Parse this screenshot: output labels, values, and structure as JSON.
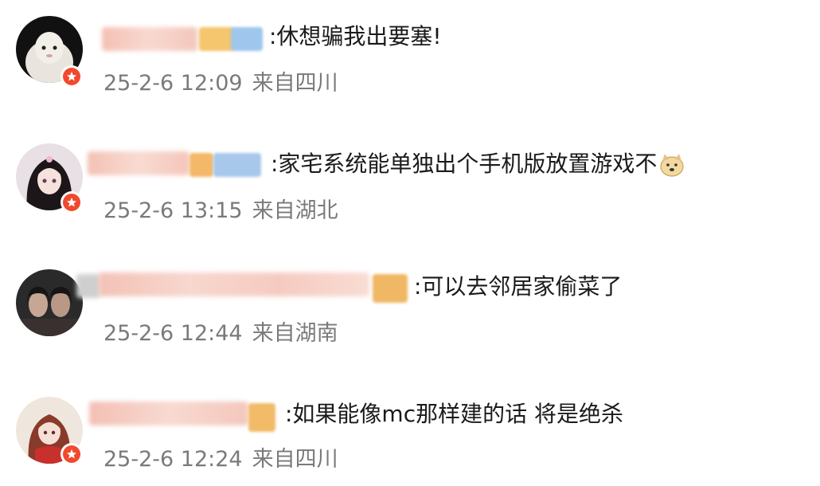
{
  "comments": [
    {
      "text": ":休想骗我出要塞!",
      "date": "25-2-6 12:09",
      "location": "来自四川",
      "avatar_icon": "white-ghost-avatar"
    },
    {
      "text": ":家宅系统能单独出个手机版放置游戏不",
      "date": "25-2-6 13:15",
      "location": "来自湖北",
      "avatar_icon": "anime-girl-avatar",
      "emoji": "doge-emoji"
    },
    {
      "text": ":可以去邻居家偷菜了",
      "date": "25-2-6 12:44",
      "location": "来自湖南",
      "avatar_icon": "two-people-photo-avatar"
    },
    {
      "text": ":如果能像mc那样建的话 将是绝杀",
      "date": "25-2-6 12:24",
      "location": "来自四川",
      "avatar_icon": "anime-girl-red-avatar"
    }
  ],
  "colors": {
    "badge": "#f04a2e",
    "meta_text": "#7a7a7a",
    "body_text": "#1a1a1a",
    "name_blur": "#f6c9c0"
  }
}
